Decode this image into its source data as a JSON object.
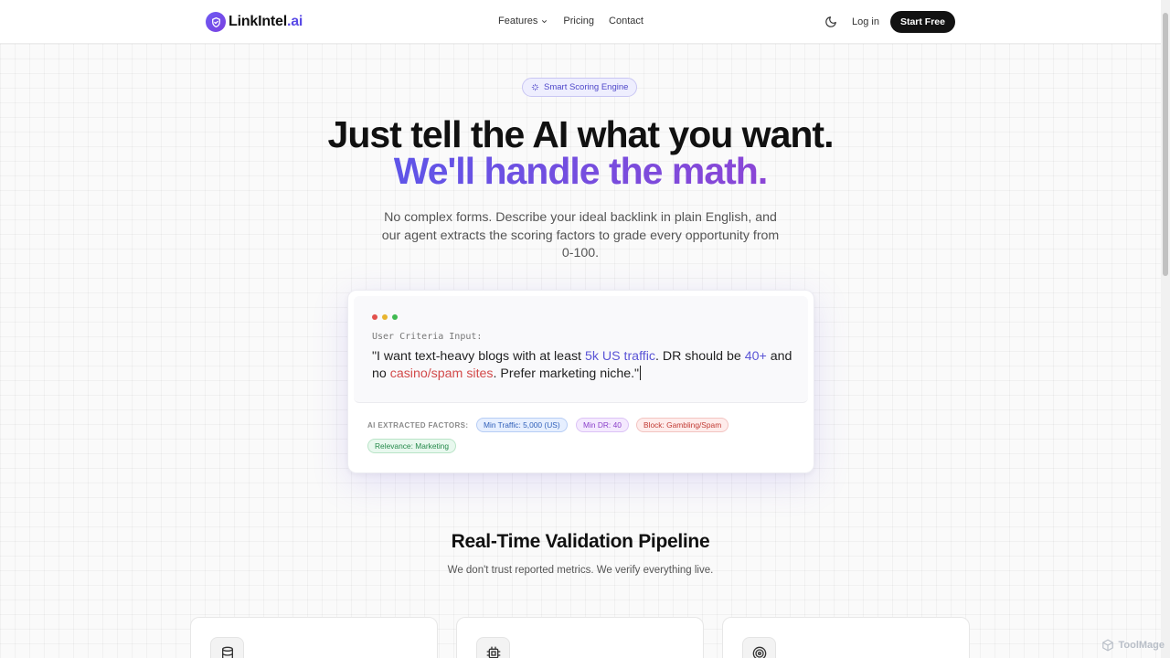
{
  "nav": {
    "logo_main": "LinkIntel",
    "logo_accent": ".ai",
    "links": [
      "Features",
      "Pricing",
      "Contact"
    ],
    "login": "Log in",
    "cta": "Start Free",
    "icons": {
      "logo": "shield-check-icon",
      "features_chevron": "chevron-down-icon",
      "theme": "moon-icon"
    }
  },
  "hero": {
    "badge": "Smart Scoring Engine",
    "badge_icon": "sparkles-icon",
    "headline_1": "Just tell the AI what you want.",
    "headline_2": "We'll handle the math.",
    "subtitle": "No complex forms. Describe your ideal backlink in plain English, and our agent extracts the scoring factors to grade every opportunity from 0-100."
  },
  "demo_card": {
    "input_label": "User Criteria Input:",
    "input_text_parts": [
      {
        "text": "\"I want text-heavy blogs with at least ",
        "style": "normal"
      },
      {
        "text": "5k US traffic",
        "style": "highlight"
      },
      {
        "text": ". DR should be ",
        "style": "normal"
      },
      {
        "text": "40+",
        "style": "highlight"
      },
      {
        "text": " and no ",
        "style": "normal"
      },
      {
        "text": "casino/spam sites",
        "style": "warning"
      },
      {
        "text": ". Prefer marketing niche.\"",
        "style": "normal"
      }
    ],
    "factors_label": "AI EXTRACTED FACTORS:",
    "factors": [
      {
        "label": "Min Traffic: 5,000 (US)",
        "color": "blue"
      },
      {
        "label": "Min DR: 40",
        "color": "purple"
      },
      {
        "label": "Block: Gambling/Spam",
        "color": "red"
      },
      {
        "label": "Relevance: Marketing",
        "color": "green"
      }
    ],
    "window_dots": [
      "#e2504c",
      "#e8b42e",
      "#3fb950"
    ]
  },
  "pipeline": {
    "title": "Real-Time Validation Pipeline",
    "subtitle": "We don't trust reported metrics. We verify everything live.",
    "cards": [
      {
        "icon": "database-icon"
      },
      {
        "icon": "cpu-icon"
      },
      {
        "icon": "target-icon"
      }
    ]
  },
  "watermark": "ToolMage",
  "colors": {
    "accent": "#5a4be6",
    "accent_gradient_end": "#8b46d6",
    "cta_bg": "#121212"
  }
}
